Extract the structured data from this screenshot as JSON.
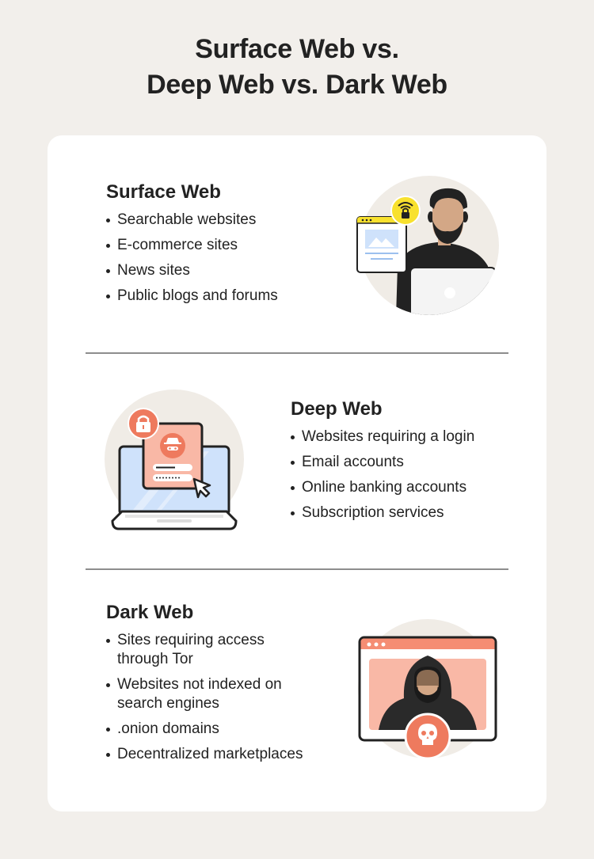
{
  "title": {
    "line1": "Surface Web vs.",
    "line2": "Deep Web vs. Dark Web"
  },
  "sections": [
    {
      "heading": "Surface Web",
      "items": [
        "Searchable websites",
        "E-commerce sites",
        "News sites",
        "Public blogs and forums"
      ],
      "illustration": "person-with-laptop-and-secure-wifi-icon"
    },
    {
      "heading": "Deep Web",
      "items": [
        "Websites requiring a login",
        "Email accounts",
        "Online banking accounts",
        "Subscription services"
      ],
      "illustration": "laptop-with-login-form-icon"
    },
    {
      "heading": "Dark Web",
      "items": [
        "Sites requiring access through Tor",
        "Websites not indexed on search engines",
        ".onion domains",
        "Decentralized marketplaces"
      ],
      "illustration": "hooded-hacker-with-skull-icon"
    }
  ],
  "colors": {
    "background": "#f2efeb",
    "card": "#ffffff",
    "text": "#222222",
    "accent_yellow": "#f8e12e",
    "accent_coral": "#ee7a5e",
    "accent_salmon": "#f9b8a6",
    "accent_blue": "#cfe2fb",
    "skin": "#d3a786"
  }
}
